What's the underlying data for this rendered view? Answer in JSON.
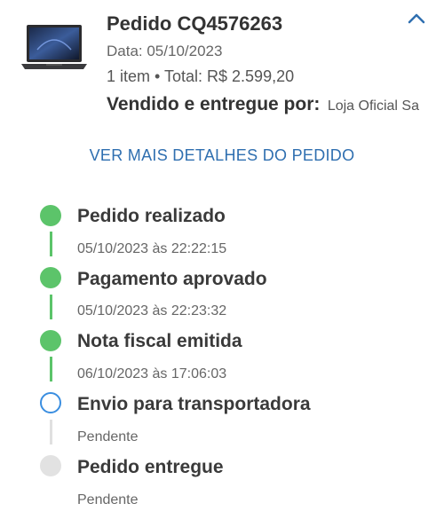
{
  "order": {
    "title": "Pedido CQ4576263",
    "date": "Data: 05/10/2023",
    "summary": "1 item • Total: R$ 2.599,20",
    "seller_label": "Vendido e entregue por:",
    "seller_name": "Loja Oficial Sa",
    "image_icon": "laptop-image",
    "collapse_icon": "chevron-up-icon"
  },
  "details_link": "VER MAIS DETALHES DO PEDIDO",
  "timeline": [
    {
      "title": "Pedido realizado",
      "subtitle": "05/10/2023 às 22:22:15",
      "status": "done"
    },
    {
      "title": "Pagamento aprovado",
      "subtitle": "05/10/2023 às 22:23:32",
      "status": "done"
    },
    {
      "title": "Nota fiscal emitida",
      "subtitle": "06/10/2023 às 17:06:03",
      "status": "done"
    },
    {
      "title": "Envio para transportadora",
      "subtitle": "Pendente",
      "status": "current"
    },
    {
      "title": "Pedido entregue",
      "subtitle": "Pendente",
      "status": "pending"
    }
  ],
  "colors": {
    "accent": "#2f6fb0",
    "done": "#5cc46a",
    "current": "#3a8ee0",
    "pending": "#e2e2e2"
  }
}
